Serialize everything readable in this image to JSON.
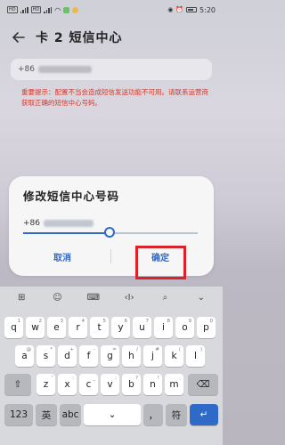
{
  "status_bar": {
    "left_sim1": "HD",
    "left_sim2": "HD",
    "time": "5:20"
  },
  "header": {
    "back_icon": "arrow-left-icon",
    "title": "卡 2 短信中心"
  },
  "number_field": {
    "prefix": "+86"
  },
  "warning": "重要提示：配置不当会造成短信发送功能不可用。请联系运营商获取正确的短信中心号码。",
  "dialog": {
    "title": "修改短信中心号码",
    "input_prefix": "+86",
    "cancel_label": "取消",
    "ok_label": "确定",
    "accent": "#2f6ac8",
    "highlight_color": "#d8232a"
  },
  "keyboard": {
    "toolbar": [
      "⊞",
      "☺",
      "⌨",
      "‹I›",
      "⌕",
      "⌄"
    ],
    "row1": [
      {
        "k": "q",
        "s": "1"
      },
      {
        "k": "w",
        "s": "2"
      },
      {
        "k": "e",
        "s": "3"
      },
      {
        "k": "r",
        "s": "4"
      },
      {
        "k": "t",
        "s": "5"
      },
      {
        "k": "y",
        "s": "6"
      },
      {
        "k": "u",
        "s": "7"
      },
      {
        "k": "i",
        "s": "8"
      },
      {
        "k": "o",
        "s": "9"
      },
      {
        "k": "p",
        "s": "0"
      }
    ],
    "row2": [
      {
        "k": "a",
        "s": "@"
      },
      {
        "k": "s",
        "s": "*"
      },
      {
        "k": "d",
        "s": "+"
      },
      {
        "k": "f",
        "s": "-"
      },
      {
        "k": "g",
        "s": "="
      },
      {
        "k": "h",
        "s": "/"
      },
      {
        "k": "j",
        "s": "#"
      },
      {
        "k": "k",
        "s": "("
      },
      {
        "k": "l",
        "s": ")"
      }
    ],
    "row3": [
      {
        "k": "z",
        "s": "'"
      },
      {
        "k": "x",
        "s": ":"
      },
      {
        "k": "c",
        "s": "_"
      },
      {
        "k": "v",
        "s": ";"
      },
      {
        "k": "b",
        "s": "?"
      },
      {
        "k": "n",
        "s": "!"
      },
      {
        "k": "m",
        "s": ","
      }
    ],
    "shift": "⇧",
    "backspace": "⌫",
    "num_key": "123",
    "lang_key": "英",
    "abc_key": "abc",
    "space": "⌄",
    "comma": "，",
    "symbol_key": "符",
    "enter": "↵"
  }
}
